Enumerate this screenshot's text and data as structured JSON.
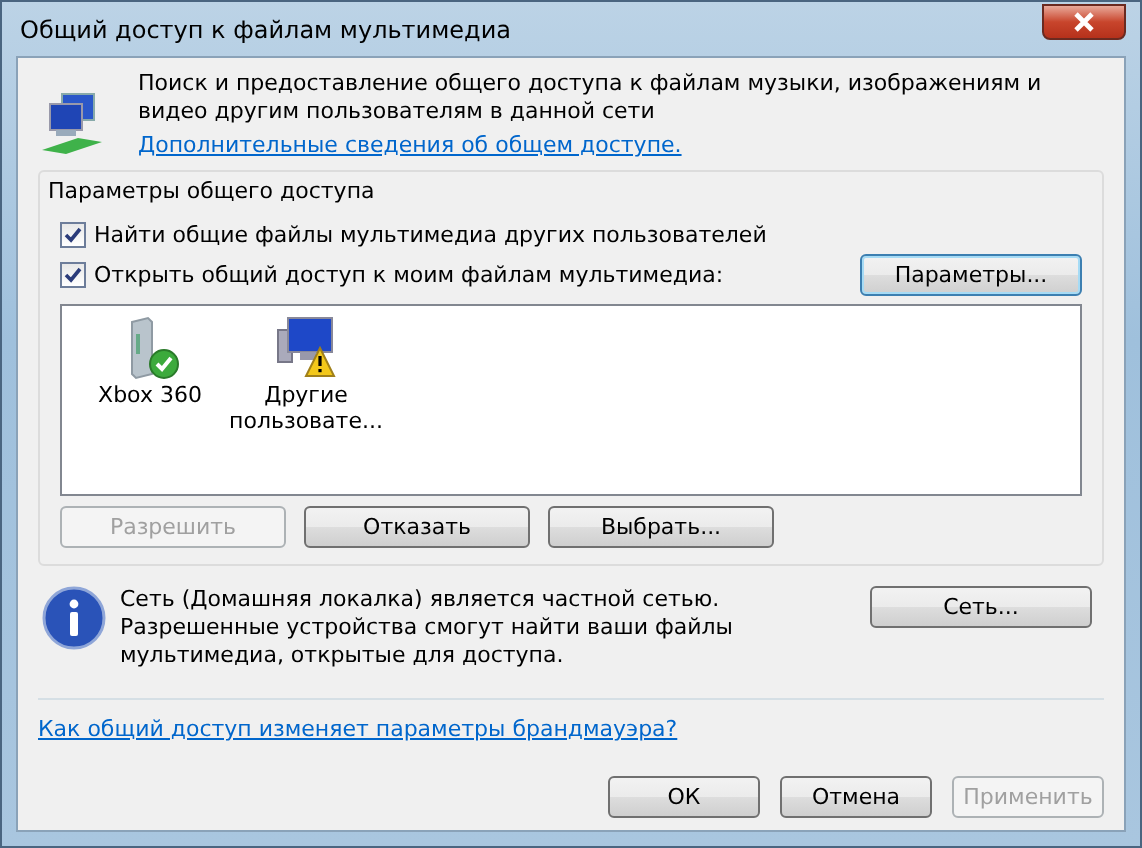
{
  "window": {
    "title": "Общий доступ к файлам мультимедиа"
  },
  "header": {
    "text": "Поиск и предоставление общего доступа к файлам музыки, изображениям и видео другим пользователям в данной сети",
    "link": "Дополнительные сведения об общем доступе."
  },
  "sharing_settings": {
    "title": "Параметры общего доступа",
    "options": [
      {
        "label": "Найти общие файлы мультимедиа других пользователей",
        "checked": true
      },
      {
        "label": "Открыть общий доступ к моим файлам мультимедиа:",
        "checked": true
      }
    ],
    "settings_button": "Параметры...",
    "devices": [
      {
        "kind": "console",
        "label": "Xbox 360",
        "allowed": true
      },
      {
        "kind": "computer",
        "label": "Другие пользовате...",
        "allowed": false
      }
    ],
    "device_buttons": [
      {
        "label": "Разрешить",
        "disabled": true
      },
      {
        "label": "Отказать",
        "disabled": false
      },
      {
        "label": "Выбрать...",
        "disabled": false
      }
    ]
  },
  "network_info": {
    "text": "Сеть (Домашняя локалка) является частной сетью. Разрешенные устройства смогут найти ваши файлы мультимедиа, открытые для доступа.",
    "button": "Сеть..."
  },
  "firewall_link": "Как общий доступ изменяет параметры брандмауэра?",
  "buttons": [
    {
      "label": "ОК",
      "disabled": false
    },
    {
      "label": "Отмена",
      "disabled": false
    },
    {
      "label": "Применить",
      "disabled": true
    }
  ]
}
